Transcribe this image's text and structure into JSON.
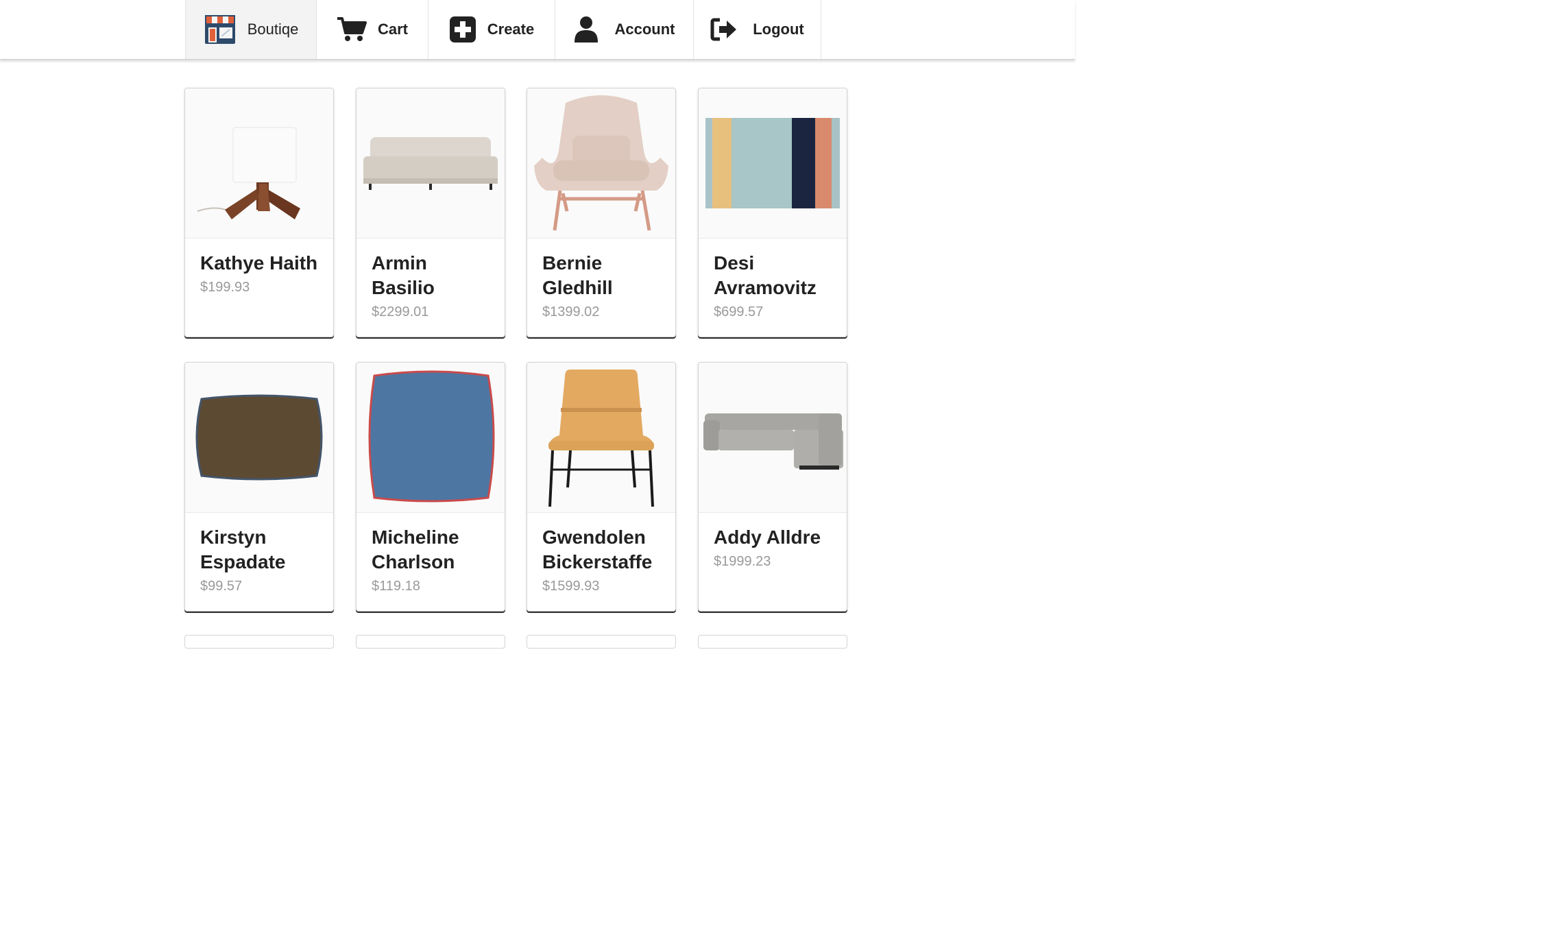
{
  "nav": {
    "items": [
      {
        "label": "Boutiqe",
        "icon": "storefront-icon",
        "active": true
      },
      {
        "label": "Cart",
        "icon": "cart-icon",
        "active": false
      },
      {
        "label": "Create",
        "icon": "plus-square-icon",
        "active": false
      },
      {
        "label": "Account",
        "icon": "user-icon",
        "active": false
      },
      {
        "label": "Logout",
        "icon": "sign-out-icon",
        "active": false
      }
    ]
  },
  "products": [
    {
      "name": "Kathye Haith",
      "price": "$199.93",
      "image": "table-lamp"
    },
    {
      "name": "Armin Basilio",
      "price": "$2299.01",
      "image": "sofa"
    },
    {
      "name": "Bernie Gledhill",
      "price": "$1399.02",
      "image": "lounge-chair"
    },
    {
      "name": "Desi Avramovitz",
      "price": "$699.57",
      "image": "striped-rug"
    },
    {
      "name": "Kirstyn Espadate",
      "price": "$99.57",
      "image": "lumbar-pillow"
    },
    {
      "name": "Micheline Charlson",
      "price": "$119.18",
      "image": "square-pillow"
    },
    {
      "name": "Gwendolen Bickerstaffe",
      "price": "$1599.93",
      "image": "leather-chair"
    },
    {
      "name": "Addy Alldre",
      "price": "$1999.23",
      "image": "sectional-sofa"
    }
  ],
  "colors": {
    "card_shadow": "#2c2c2c",
    "price_text": "#999999",
    "active_nav_bg": "#f3f3f3"
  }
}
